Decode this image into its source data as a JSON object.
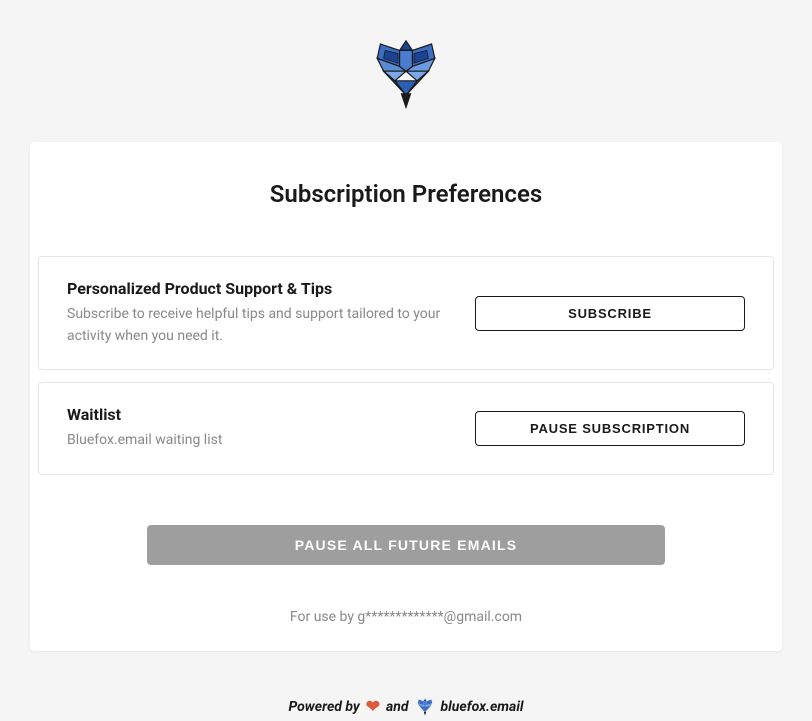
{
  "title": "Subscription Preferences",
  "preferences": [
    {
      "title": "Personalized Product Support & Tips",
      "description": "Subscribe to receive helpful tips and support tailored to your activity when you need it.",
      "button": "SUBSCRIBE"
    },
    {
      "title": "Waitlist",
      "description": "Bluefox.email waiting list",
      "button": "PAUSE SUBSCRIPTION"
    }
  ],
  "pause_all_label": "PAUSE ALL FUTURE EMAILS",
  "footer_note": "For use by g*************@gmail.com",
  "powered": {
    "prefix": "Powered  by",
    "and": "and",
    "brand": "bluefox.email"
  },
  "colors": {
    "fox_blue_light": "#5a8cd6",
    "fox_blue_mid": "#3a6fc4",
    "fox_blue_dark": "#1a4394",
    "fox_dark": "#1a1a1a",
    "heart": "#e05a3c"
  }
}
